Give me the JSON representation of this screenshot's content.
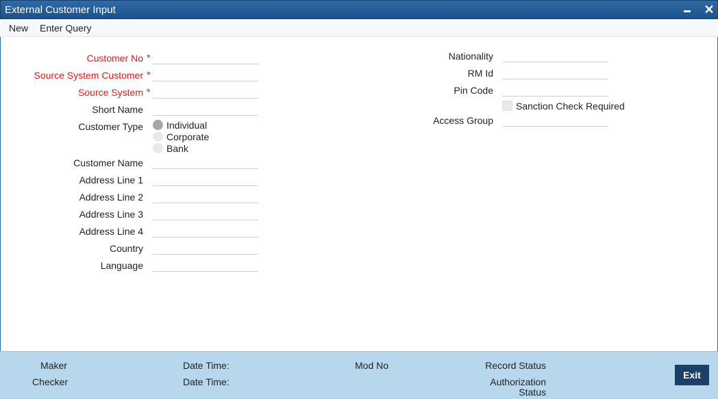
{
  "window": {
    "title": "External Customer Input",
    "minimize_icon": "minimize-icon",
    "close_icon": "close-icon",
    "close_glyph": "✕"
  },
  "menu": {
    "new": "New",
    "enter_query": "Enter Query"
  },
  "form": {
    "required_marker": "*",
    "customer_no": {
      "label": "Customer No",
      "value": ""
    },
    "source_system_customer": {
      "label": "Source System Customer",
      "value": ""
    },
    "source_system": {
      "label": "Source System",
      "value": ""
    },
    "short_name": {
      "label": "Short Name",
      "value": ""
    },
    "customer_type": {
      "label": "Customer Type",
      "options": [
        "Individual",
        "Corporate",
        "Bank"
      ],
      "selected": "Individual"
    },
    "customer_name": {
      "label": "Customer Name",
      "value": ""
    },
    "address_line_1": {
      "label": "Address Line 1",
      "value": ""
    },
    "address_line_2": {
      "label": "Address Line 2",
      "value": ""
    },
    "address_line_3": {
      "label": "Address Line 3",
      "value": ""
    },
    "address_line_4": {
      "label": "Address Line 4",
      "value": ""
    },
    "country": {
      "label": "Country",
      "value": ""
    },
    "language": {
      "label": "Language",
      "value": ""
    },
    "nationality": {
      "label": "Nationality",
      "value": ""
    },
    "rm_id": {
      "label": "RM Id",
      "value": ""
    },
    "pin_code": {
      "label": "Pin Code",
      "value": ""
    },
    "sanction_check": {
      "label": "Sanction Check Required",
      "checked": false
    },
    "access_group": {
      "label": "Access Group",
      "value": ""
    }
  },
  "footer": {
    "maker": "Maker",
    "checker": "Checker",
    "date_time_1": "Date Time:",
    "date_time_2": "Date Time:",
    "mod_no": "Mod No",
    "record_status": "Record Status",
    "authorization_status_line1": "Authorization",
    "authorization_status_line2": "Status",
    "exit_label": "Exit"
  },
  "colors": {
    "titlebar": "#1d5189",
    "required": "#e01b1b",
    "footer": "#b7d8ec",
    "exit_button": "#1b3f67"
  }
}
